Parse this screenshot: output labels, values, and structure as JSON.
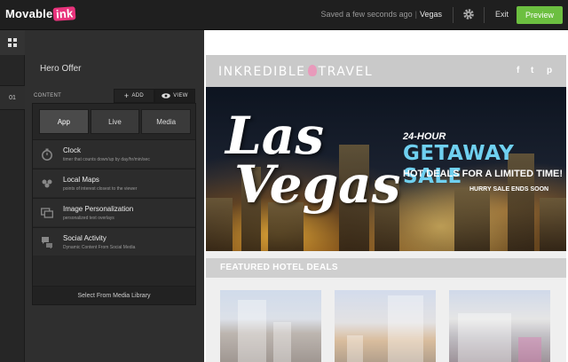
{
  "app": {
    "logo_text": "Movable",
    "logo_accent": "ink",
    "status": "Saved a few seconds ago",
    "project": "Vegas",
    "exit_label": "Exit",
    "preview_label": "Preview",
    "colors": {
      "accent": "#6cbf40",
      "logo": "#e8337c",
      "topbar": "#1f1f1f"
    }
  },
  "rail": {
    "grid_icon": "grid-icon",
    "slot_label": "01"
  },
  "panel": {
    "title": "Hero Offer",
    "content_label": "CONTENT",
    "add_label": "ADD",
    "view_label": "VIEW",
    "tabs": [
      {
        "label": "App",
        "active": true
      },
      {
        "label": "Live",
        "active": false
      },
      {
        "label": "Media",
        "active": false
      }
    ],
    "apps": [
      {
        "icon": "clock-icon",
        "title": "Clock",
        "desc": "timer that counts down/up by day/hr/min/sec"
      },
      {
        "icon": "map-pins-icon",
        "title": "Local Maps",
        "desc": "points of interest closest to the viewer"
      },
      {
        "icon": "image-personalization-icon",
        "title": "Image Personalization",
        "desc": "personalized text overlays"
      },
      {
        "icon": "chat-bubbles-icon",
        "title": "Social Activity",
        "desc": "Dynamic Content From Social Media"
      }
    ],
    "library_label": "Select From Media Library"
  },
  "email": {
    "brand_left": "INKREDIBLE",
    "brand_right": "TRAVEL",
    "social": [
      "f",
      "t",
      "p"
    ],
    "hero": {
      "script_line1": "Las",
      "script_line2": "Vegas",
      "line_24h": "24-HOUR",
      "getaway": "GETAWAY SALE",
      "hot_deals": "HOT DEALS FOR A LIMITED TIME!",
      "hurry": "HURRY SALE ENDS SOON"
    },
    "featured_label": "FEATURED HOTEL DEALS"
  }
}
